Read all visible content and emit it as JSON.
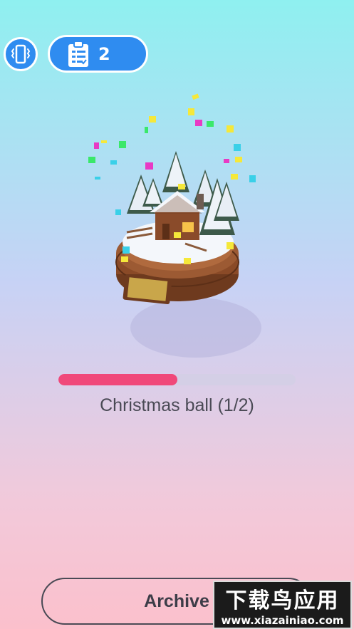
{
  "header": {
    "tasks_count": "2"
  },
  "progress": {
    "value": 0.5
  },
  "level": {
    "title": "Christmas ball (1/2)"
  },
  "footer": {
    "archive_label": "Archive"
  },
  "watermark": {
    "text_cn": "下载鸟应用",
    "url": "www.xiazainiao.com"
  },
  "colors": {
    "button_blue": "#2f8cf0",
    "progress_fill": "#f0487a",
    "progress_track": "#d4cfe6"
  },
  "icons": {
    "vibrate": "phone-vibrate-icon",
    "tasks": "clipboard-checklist-icon"
  }
}
